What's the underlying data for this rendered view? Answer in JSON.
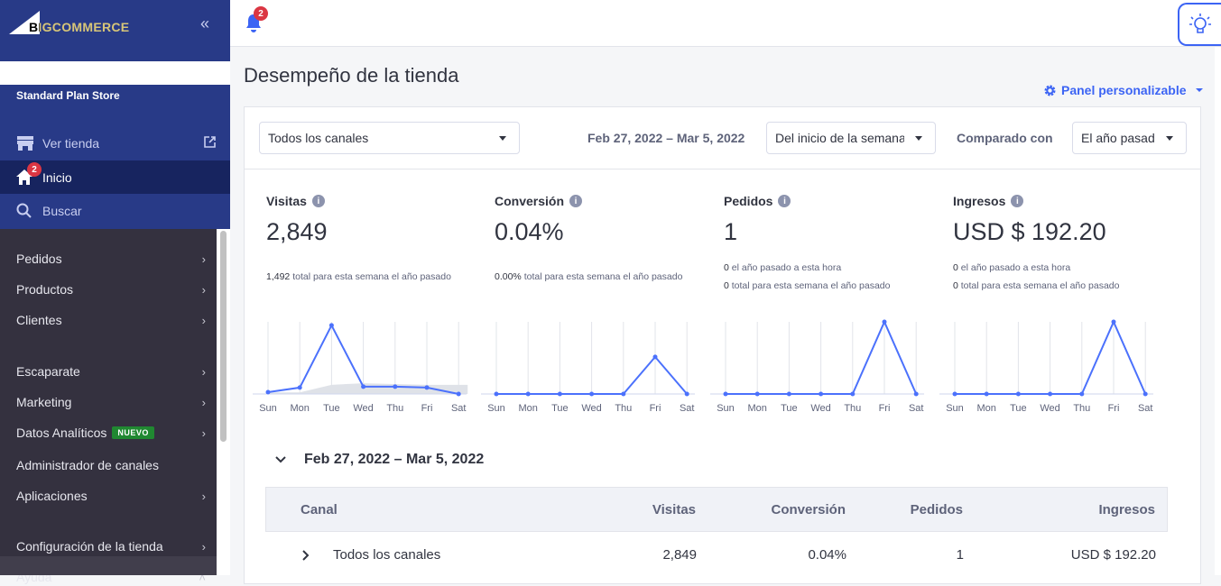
{
  "brand": {
    "logo_text": "BIGCOMMERCE"
  },
  "sidebar": {
    "store_name": "Standard Plan Store",
    "view_store": "Ver tienda",
    "home": "Inicio",
    "home_badge": "2",
    "search": "Buscar",
    "items": [
      {
        "label": "Pedidos",
        "chevron": true
      },
      {
        "label": "Productos",
        "chevron": true
      },
      {
        "label": "Clientes",
        "chevron": true
      },
      {
        "label": "Escaparate",
        "chevron": true
      },
      {
        "label": "Marketing",
        "chevron": true
      },
      {
        "label": "Datos Analíticos",
        "badge": "NUEVO",
        "chevron": true
      },
      {
        "label": "Administrador de canales",
        "chevron": false
      },
      {
        "label": "Aplicaciones",
        "chevron": true
      },
      {
        "label": "Configuración de la tienda",
        "chevron": true
      },
      {
        "label": "Ayuda",
        "chevron": true
      }
    ]
  },
  "topbar": {
    "notifications_count": "2"
  },
  "page": {
    "title": "Desempeño de la tienda",
    "panel_link": "Panel personalizable"
  },
  "filters": {
    "channel": "Todos los canales",
    "date_range": "Feb 27, 2022 – Mar 5, 2022",
    "period": "Del inicio de la semana",
    "compare_label": "Comparado con",
    "compare": "El año pasado"
  },
  "metrics": [
    {
      "title": "Visitas",
      "value": "2,849",
      "sub": [
        {
          "b": "1,492",
          "t": " total para esta semana el año pasado"
        }
      ]
    },
    {
      "title": "Conversión",
      "value": "0.04%",
      "sub": [
        {
          "b": "0.00%",
          "t": " total para esta semana el año pasado"
        }
      ]
    },
    {
      "title": "Pedidos",
      "value": "1",
      "sub": [
        {
          "b": "0",
          "t": " el año pasado a esta hora"
        },
        {
          "b": "0",
          "t": " total para esta semana el año pasado"
        }
      ]
    },
    {
      "title": "Ingresos",
      "value": "USD $ 192.20",
      "sub": [
        {
          "b": "0",
          "t": " el año pasado a esta hora"
        },
        {
          "b": "0",
          "t": " total para esta semana el año pasado"
        }
      ]
    }
  ],
  "chart_data": [
    {
      "type": "line",
      "categories": [
        "Sun",
        "Mon",
        "Tue",
        "Wed",
        "Thu",
        "Fri",
        "Sat"
      ],
      "series": [
        {
          "values": [
            53,
            186,
            1997,
            213,
            213,
            186,
            0
          ]
        },
        {
          "values": [
            45,
            45,
            267,
            312,
            290,
            267,
            267
          ],
          "style": "area"
        }
      ],
      "ylim": [
        0,
        2100
      ],
      "grid": "vertical"
    },
    {
      "type": "line",
      "categories": [
        "Sun",
        "Mon",
        "Tue",
        "Wed",
        "Thu",
        "Fri",
        "Sat"
      ],
      "series": [
        {
          "values": [
            0,
            0,
            0,
            0,
            0,
            0.54,
            0
          ]
        },
        {
          "values": [
            0,
            0,
            0,
            0,
            0,
            0,
            0
          ],
          "style": "area"
        }
      ],
      "ylim": [
        0,
        1.05
      ],
      "grid": "vertical"
    },
    {
      "type": "line",
      "categories": [
        "Sun",
        "Mon",
        "Tue",
        "Wed",
        "Thu",
        "Fri",
        "Sat"
      ],
      "series": [
        {
          "values": [
            0,
            0,
            0,
            0,
            0,
            1,
            0
          ]
        },
        {
          "values": [
            0,
            0,
            0,
            0,
            0,
            0,
            0
          ],
          "style": "area"
        }
      ],
      "ylim": [
        0,
        1
      ],
      "grid": "vertical"
    },
    {
      "type": "line",
      "categories": [
        "Sun",
        "Mon",
        "Tue",
        "Wed",
        "Thu",
        "Fri",
        "Sat"
      ],
      "series": [
        {
          "values": [
            0,
            0,
            0,
            0,
            0,
            192.2,
            0
          ]
        },
        {
          "values": [
            0,
            0,
            0,
            0,
            0,
            0,
            0
          ],
          "style": "area"
        }
      ],
      "ylim": [
        0,
        192.2
      ],
      "grid": "vertical"
    }
  ],
  "colors": {
    "line": "#4b71fc",
    "area": "#dfe2e8",
    "accent": "#3c64f4",
    "sidebar_top": "#283a87",
    "sidebar": "#34313f"
  },
  "section": {
    "title": "Feb 27, 2022 – Mar 5, 2022"
  },
  "table": {
    "headers": [
      "Canal",
      "Visitas",
      "Conversión",
      "Pedidos",
      "Ingresos"
    ],
    "rows": [
      [
        "Todos los canales",
        "2,849",
        "0.04%",
        "1",
        "USD $ 192.20"
      ]
    ]
  }
}
